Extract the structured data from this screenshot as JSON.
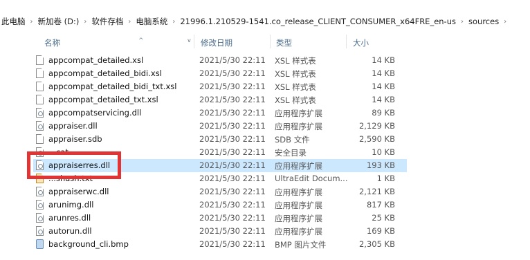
{
  "breadcrumb": [
    "此电脑",
    "新加卷 (D:)",
    "软件存档",
    "电脑系统",
    "21996.1.210529-1541.co_release_CLIENT_CONSUMER_x64FRE_en-us",
    "sources"
  ],
  "columns": {
    "name": "名称",
    "date": "修改日期",
    "type": "类型",
    "size": "大小"
  },
  "files": [
    {
      "name": "appcompat_detailed.xsl",
      "date": "2021/5/30 22:11",
      "type": "XSL 样式表",
      "size": "14 KB",
      "icon": "document-icon"
    },
    {
      "name": "appcompat_detailed_bidi.xsl",
      "date": "2021/5/30 22:11",
      "type": "XSL 样式表",
      "size": "14 KB",
      "icon": "document-icon"
    },
    {
      "name": "appcompat_detailed_bidi_txt.xsl",
      "date": "2021/5/30 22:11",
      "type": "XSL 样式表",
      "size": "14 KB",
      "icon": "document-icon"
    },
    {
      "name": "appcompat_detailed_txt.xsl",
      "date": "2021/5/30 22:11",
      "type": "XSL 样式表",
      "size": "14 KB",
      "icon": "document-icon"
    },
    {
      "name": "appcompatservicing.dll",
      "date": "2021/5/30 22:11",
      "type": "应用程序扩展",
      "size": "89 KB",
      "icon": "dll-icon"
    },
    {
      "name": "appraiser.dll",
      "date": "2021/5/30 22:11",
      "type": "应用程序扩展",
      "size": "2,129 KB",
      "icon": "dll-icon"
    },
    {
      "name": "appraiser.sdb",
      "date": "2021/5/30 22:11",
      "type": "SDB 文件",
      "size": "2,590 KB",
      "icon": "document-icon"
    },
    {
      "name": "...cat",
      "date": "2021/5/30 22:11",
      "type": "安全目录",
      "size": "10 KB",
      "icon": "catalog-icon"
    },
    {
      "name": "appraiserres.dll",
      "date": "2021/5/30 22:11",
      "type": "应用程序扩展",
      "size": "193 KB",
      "icon": "dll-icon",
      "selected": true
    },
    {
      "name": "...shash.txt",
      "date": "2021/5/30 22:11",
      "type": "UltraEdit Docum...",
      "size": "1 KB",
      "icon": "text-file-icon"
    },
    {
      "name": "appraiserwc.dll",
      "date": "2021/5/30 22:11",
      "type": "应用程序扩展",
      "size": "2,121 KB",
      "icon": "dll-icon"
    },
    {
      "name": "arunimg.dll",
      "date": "2021/5/30 22:11",
      "type": "应用程序扩展",
      "size": "817 KB",
      "icon": "dll-icon"
    },
    {
      "name": "arunres.dll",
      "date": "2021/5/30 22:11",
      "type": "应用程序扩展",
      "size": "25 KB",
      "icon": "dll-icon"
    },
    {
      "name": "autorun.dll",
      "date": "2021/5/30 22:11",
      "type": "应用程序扩展",
      "size": "169 KB",
      "icon": "dll-icon"
    },
    {
      "name": "background_cli.bmp",
      "date": "2021/5/30 22:11",
      "type": "BMP 图片文件",
      "size": "2,305 KB",
      "icon": "bitmap-icon"
    }
  ],
  "colors": {
    "selection": "#cce8ff",
    "highlight_box": "#e03535",
    "header_text": "#4a6b8a"
  }
}
